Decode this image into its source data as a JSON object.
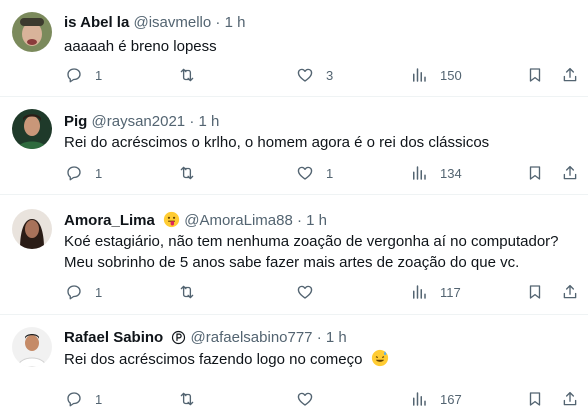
{
  "tweets": [
    {
      "name": "is Abel la",
      "handle": "@isavmello",
      "sep": "·",
      "time": "1 h",
      "text": "aaaaah é breno lopess",
      "replies": "1",
      "retweets": "",
      "likes": "3",
      "views": "150"
    },
    {
      "name": "Pig",
      "handle": "@raysan2021",
      "sep": "·",
      "time": "1 h",
      "text": "Rei do acréscimos o krlho, o homem agora é o rei dos clássicos",
      "replies": "1",
      "retweets": "",
      "likes": "1",
      "views": "134"
    },
    {
      "name": "Amora_Lima",
      "handle": "@AmoraLima88",
      "sep": "·",
      "time": "1 h",
      "text": "Koé estagiário, não tem nenhuma zoação de vergonha aí no computador? Meu sobrinho de 5 anos sabe fazer mais artes de zoação do que vc.",
      "replies": "1",
      "retweets": "",
      "likes": "",
      "views": "117"
    },
    {
      "name": "Rafael Sabino",
      "handle": "@rafaelsabino777",
      "sep": "·",
      "time": "1 h",
      "text": "Rei dos acréscimos fazendo logo no começo",
      "replies": "1",
      "retweets": "",
      "likes": "",
      "views": "167"
    }
  ],
  "icons": {
    "reply": "reply-icon",
    "retweet": "retweet-icon",
    "like": "heart-icon",
    "views": "views-icon",
    "bookmark": "bookmark-icon",
    "share": "share-icon",
    "badge_name_emoji": "tongue-face-emoji-icon",
    "badge_registered": "registered-p-icon",
    "text_emoji": "sweat-smile-emoji-icon"
  },
  "colors": {
    "text": "#0f1419",
    "secondary": "#536471",
    "divider": "#eff3f4"
  }
}
